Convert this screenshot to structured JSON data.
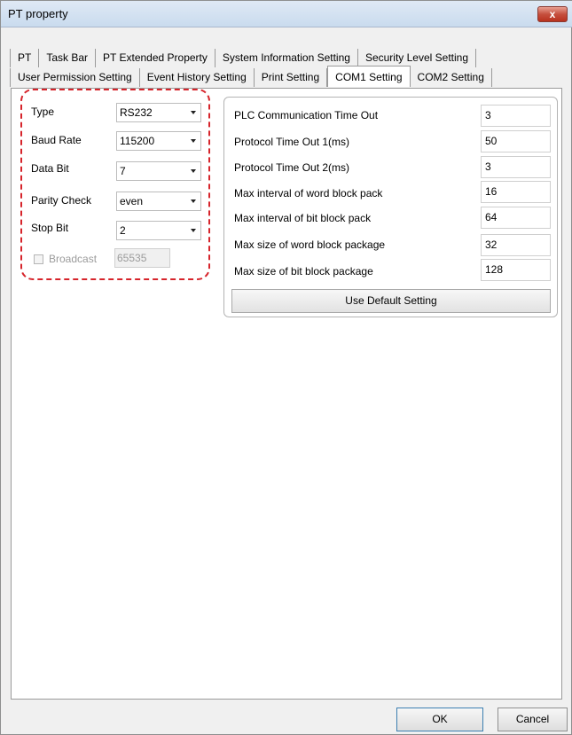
{
  "window": {
    "title": "PT property",
    "close_label": "x"
  },
  "tabs_row1": [
    "PT",
    "Task Bar",
    "PT Extended Property",
    "System Information Setting",
    "Security Level Setting"
  ],
  "tabs_row2": [
    "User Permission Setting",
    "Event History Setting",
    "Print Setting",
    "COM1 Setting",
    "COM2 Setting"
  ],
  "active_tab": "COM1 Setting",
  "left": {
    "type_label": "Type",
    "type_value": "RS232",
    "baud_label": "Baud Rate",
    "baud_value": "115200",
    "databit_label": "Data Bit",
    "databit_value": "7",
    "parity_label": "Parity Check",
    "parity_value": "even",
    "stopbit_label": "Stop Bit",
    "stopbit_value": "2",
    "broadcast_label": "Broadcast",
    "broadcast_value": "65535"
  },
  "right": {
    "fields": [
      {
        "label": "PLC Communication Time Out",
        "value": "3"
      },
      {
        "label": "Protocol Time Out 1(ms)",
        "value": "50"
      },
      {
        "label": "Protocol Time Out 2(ms)",
        "value": "3"
      },
      {
        "label": "Max interval of word block pack",
        "value": "16"
      },
      {
        "label": "Max interval of bit block pack",
        "value": "64"
      },
      {
        "label": "Max size of word block package",
        "value": "32"
      },
      {
        "label": "Max size of bit block package",
        "value": "128"
      }
    ],
    "default_button": "Use Default Setting"
  },
  "buttons": {
    "ok": "OK",
    "cancel": "Cancel"
  },
  "colors": {
    "highlight": "#d6242b"
  }
}
